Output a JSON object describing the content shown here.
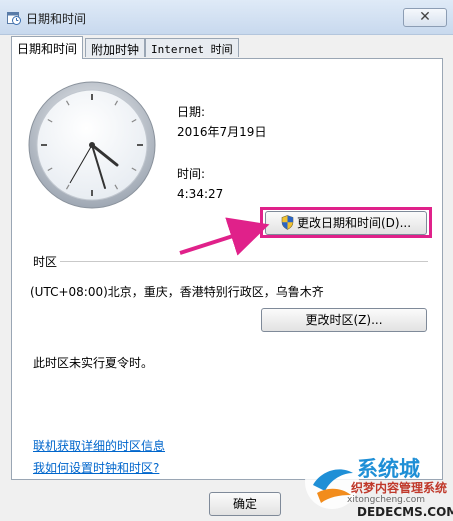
{
  "window": {
    "title": "日期和时间",
    "close_glyph": "✕"
  },
  "tabs": [
    {
      "label": "日期和时间",
      "active": true
    },
    {
      "label": "附加时钟",
      "active": false
    },
    {
      "label": "Internet 时间",
      "active": false
    }
  ],
  "date_time": {
    "date_label": "日期:",
    "date_value": "2016年7月19日",
    "time_label": "时间:",
    "time_value": "4:34:27",
    "change_button": "更改日期和时间(D)..."
  },
  "timezone": {
    "section_label": "时区",
    "value": "(UTC+08:00)北京，重庆，香港特别行政区，乌鲁木齐",
    "change_button": "更改时区(Z)...",
    "dst_note": "此时区未实行夏令时。"
  },
  "links": {
    "online_info": "联机获取详细的时区信息",
    "how_to": "我如何设置时钟和时区?"
  },
  "footer": {
    "ok_button": "确定"
  },
  "watermark": {
    "brand": "系统城",
    "slogan": "织梦内容管理系统",
    "url_top": "xitongcheng.com",
    "url_bottom": "DEDECMS.COM"
  },
  "colors": {
    "highlight": "#e0218a",
    "link": "#0066cc"
  },
  "icons": {
    "title_icon": "calendar-clock-icon",
    "button_icon": "uac-shield-icon"
  }
}
